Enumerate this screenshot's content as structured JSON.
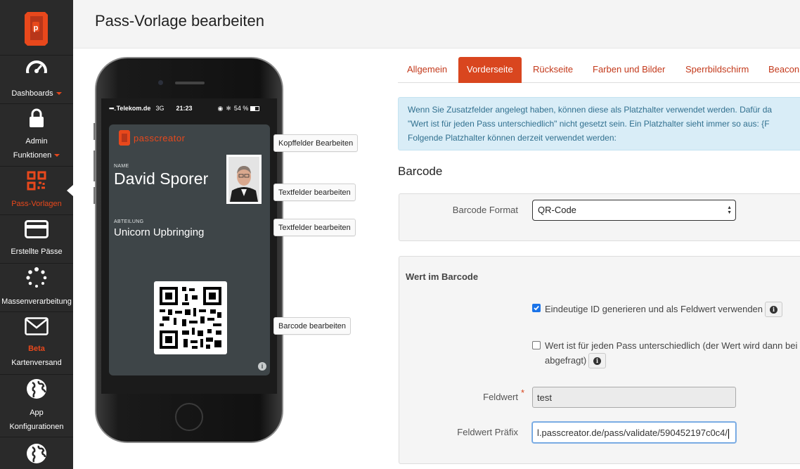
{
  "sidebar": {
    "items": [
      {
        "label": "Dashboards",
        "icon": "gauge-icon",
        "caret": true
      },
      {
        "label": "Admin",
        "label2": "Funktionen",
        "icon": "lock-icon",
        "caret": true
      },
      {
        "label": "Pass-Vorlagen",
        "icon": "qr-code-icon",
        "active": true
      },
      {
        "label": "Erstellte Pässe",
        "icon": "credit-card-icon"
      },
      {
        "label": "Massenverarbeitung",
        "icon": "spinner-icon"
      },
      {
        "badge": "Beta",
        "label": "Kartenversand",
        "icon": "envelope-icon"
      },
      {
        "label": "App",
        "label2": "Konfigurationen",
        "icon": "globe-icon"
      },
      {
        "icon": "globe-icon"
      }
    ]
  },
  "header": {
    "title": "Pass-Vorlage bearbeiten"
  },
  "phone": {
    "status": {
      "carrier": "Telekom.de",
      "network": "3G",
      "time": "21:23",
      "battery": "54 %"
    },
    "pass": {
      "brand": "passcreator",
      "name_label": "NAME",
      "name_value": "David Sporer",
      "dept_label": "ABTEILUNG",
      "dept_value": "Unicorn Upbringing"
    }
  },
  "edit_buttons": {
    "header_fields": "Kopffelder Bearbeiten",
    "text_fields_1": "Textfelder bearbeiten",
    "text_fields_2": "Textfelder bearbeiten",
    "barcode": "Barcode bearbeiten"
  },
  "tabs": [
    "Allgemein",
    "Vorderseite",
    "Rückseite",
    "Farben und Bilder",
    "Sperrbildschirm",
    "Beacon"
  ],
  "active_tab": "Vorderseite",
  "alert": {
    "line1": "Wenn Sie Zusatzfelder angelegt haben, können diese als Platzhalter verwendet werden. Dafür da",
    "line2": "\"Wert ist für jeden Pass unterschiedlich\" nicht gesetzt sein. Ein Platzhalter sieht immer so aus: {F",
    "line3": "Folgende Platzhalter können derzeit verwendet werden:"
  },
  "barcode": {
    "section_title": "Barcode",
    "format_label": "Barcode Format",
    "format_value": "QR-Code",
    "value_panel_title": "Wert im Barcode",
    "check1_label": "Eindeutige ID generieren und als Feldwert verwenden",
    "check1_checked": true,
    "check2_label_line1": "Wert ist für jeden Pass unterschiedlich (der Wert wird dann bei",
    "check2_label_line2": "abgefragt)",
    "check2_checked": false,
    "field_value_label": "Feldwert",
    "required_mark": "*",
    "field_value": "test",
    "prefix_label": "Feldwert Präfix",
    "prefix_value": "l.passcreator.de/pass/validate/590452197c0c4/"
  },
  "colors": {
    "accent": "#d9461f",
    "sidebar_bg": "#2a2a2a",
    "pass_bg": "#3e4548",
    "alert_bg": "#d9edf7"
  }
}
